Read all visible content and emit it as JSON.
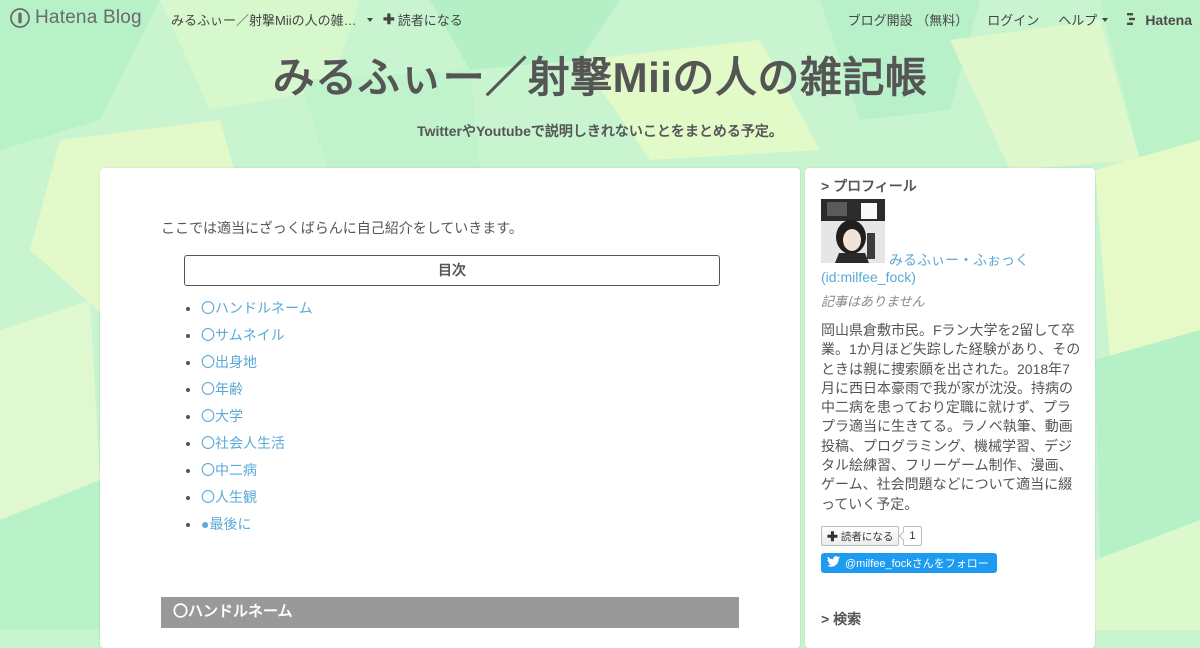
{
  "colors": {
    "bg_light_green": "#c8f4cf",
    "bg_mint": "#b5f0c6",
    "bg_yellow": "#e6fac8",
    "link_blue": "#5aa9d8",
    "heading_gray": "#999999",
    "twitter_blue": "#1d9bf0"
  },
  "navbar": {
    "logo_text": "Hatena Blog",
    "logo_icon": "hatena-blog-logo-icon",
    "blog_title": "みるふぃー／射撃Miiの人の雑…",
    "subscribe": "読者になる",
    "open_blog": "ブログ開設 （無料）",
    "login": "ログイン",
    "help": "ヘルプ",
    "hatena": "Hatena"
  },
  "header": {
    "title": "みるふぃー／射撃Miiの人の雑記帳",
    "description": "TwitterやYoutubeで説明しきれないことをまとめる予定。"
  },
  "main": {
    "intro": "ここでは適当にざっくばらんに自己紹介をしていきます。",
    "toc_title": "目次",
    "toc_items": [
      "〇ハンドルネーム",
      "〇サムネイル",
      "〇出身地",
      "〇年齢",
      "〇大学",
      "〇社会人生活",
      "〇中二病",
      "〇人生観",
      "●最後に"
    ],
    "section_heading": "〇ハンドルネーム"
  },
  "sidebar": {
    "profile_title": "> プロフィール",
    "profile_name": "みるふぃー・ふぉっく",
    "profile_id": "(id:milfee_fock)",
    "no_entries": "記事はありません",
    "bio": "岡山県倉敷市民。Fラン大学を2留して卒業。1か月ほど失踪した経験があり、そのときは親に捜索願を出された。2018年7月に西日本豪雨で我が家が沈没。持病の中二病を患っており定職に就けず、プラプラ適当に生きてる。ラノベ執筆、動画投稿、プログラミング、機械学習、デジタル絵練習、フリーゲーム制作、漫画、ゲーム、社会問題などについて適当に綴っていく予定。",
    "subscribe_label": "読者になる",
    "subscriber_count": "1",
    "twitter_label": "@milfee_fockさんをフォロー",
    "search_title": "> 検索"
  }
}
